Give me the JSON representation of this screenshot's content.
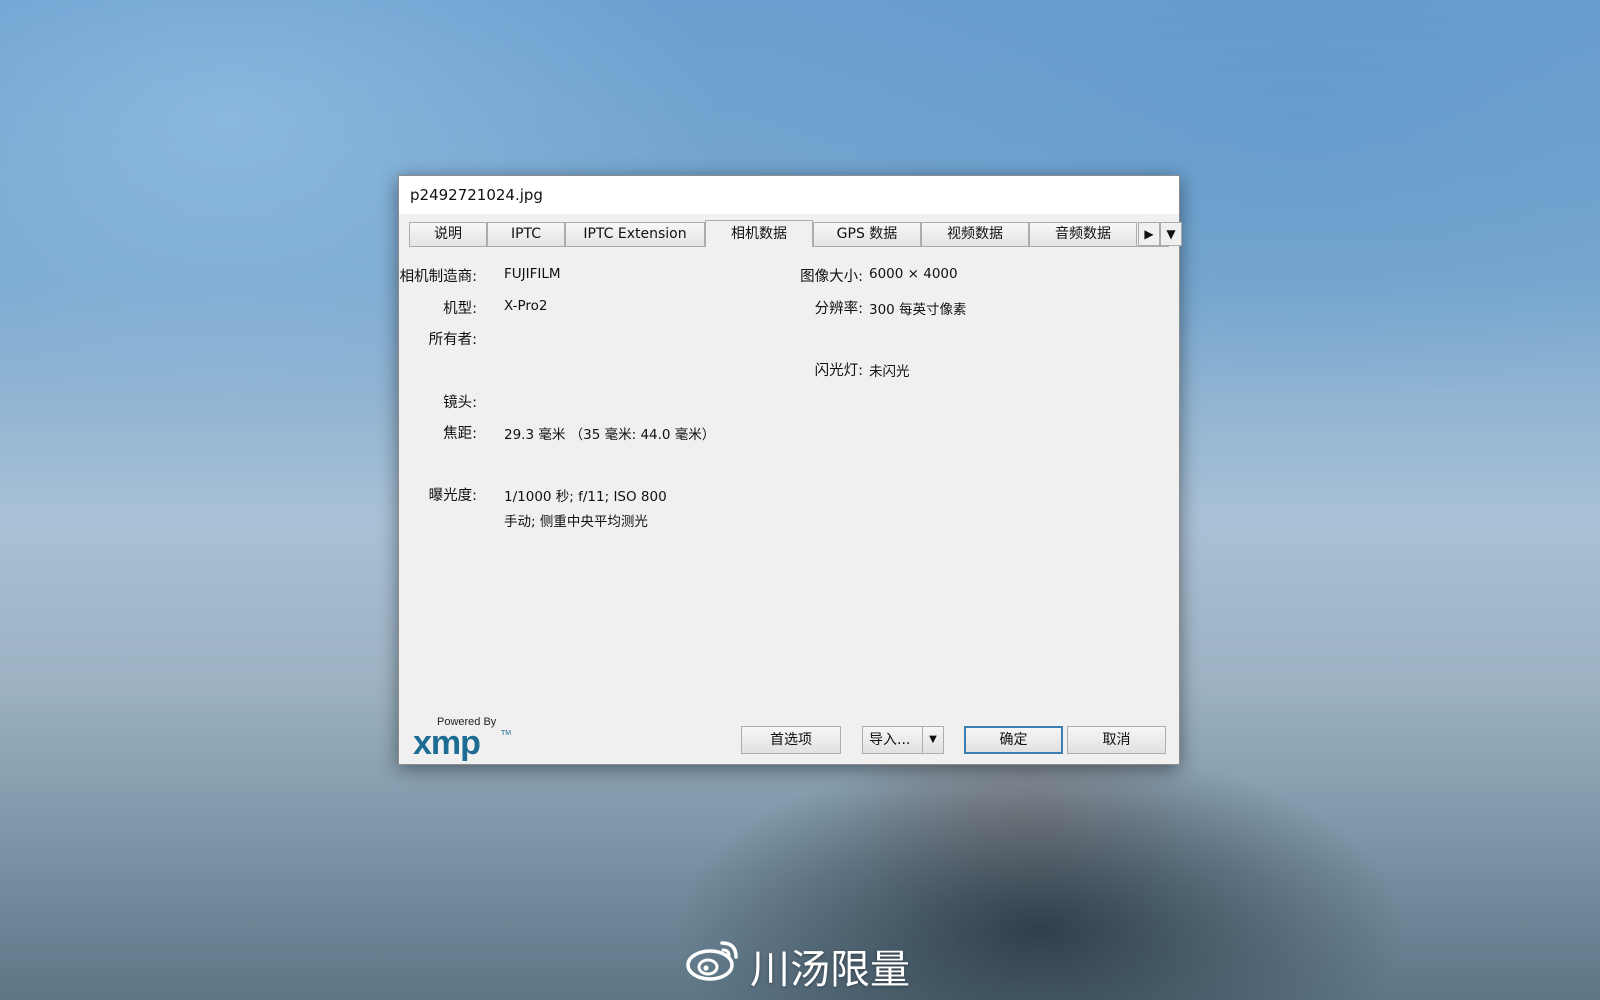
{
  "window": {
    "title": "p2492721024.jpg"
  },
  "tabs": [
    {
      "label": "说明",
      "active": false
    },
    {
      "label": "IPTC",
      "active": false
    },
    {
      "label": "IPTC Extension",
      "active": false
    },
    {
      "label": "相机数据",
      "active": true
    },
    {
      "label": "GPS 数据",
      "active": false
    },
    {
      "label": "视频数据",
      "active": false
    },
    {
      "label": "音频数据",
      "active": false
    }
  ],
  "tab_controls": {
    "next_icon": "play-right-icon",
    "menu_icon": "chevron-down-icon"
  },
  "camera": {
    "make_label": "相机制造商:",
    "make_value": "FUJIFILM",
    "model_label": "机型:",
    "model_value": "X-Pro2",
    "owner_label": "所有者:",
    "owner_value": "",
    "lens_label": "镜头:",
    "lens_value": "",
    "focal_label": "焦距:",
    "focal_value": "29.3 毫米  （35 毫米: 44.0 毫米）",
    "exposure_label": "曝光度:",
    "exposure_value": "1/1000 秒;   f/11;   ISO 800",
    "exposure_mode": "手动;   侧重中央平均测光",
    "size_label": "图像大小:",
    "size_value": "6000 × 4000",
    "resolution_label": "分辨率:",
    "resolution_value": "300 每英寸像素",
    "flash_label": "闪光灯:",
    "flash_value": "未闪光"
  },
  "logo": {
    "powered": "Powered By",
    "word": "xmp",
    "tm": "TM"
  },
  "buttons": {
    "preferences": "首选项",
    "import": "导入...",
    "import_arrow_icon": "chevron-down-icon",
    "ok": "确定",
    "cancel": "取消"
  },
  "watermark": {
    "text": "川汤限量",
    "icon": "weibo-icon"
  },
  "colors": {
    "xmp_blue": "#1d6c93",
    "default_button_border": "#3c7fb1",
    "dialog_bg": "#f0f0f0"
  }
}
